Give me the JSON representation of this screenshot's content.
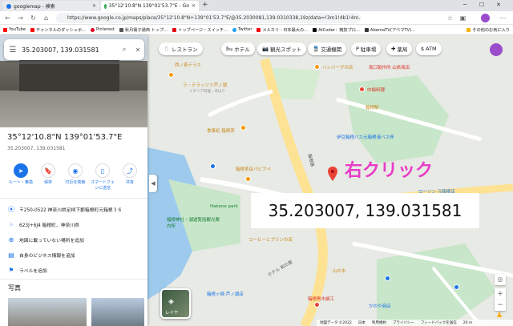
{
  "browser": {
    "tabs": [
      {
        "title": "googlemap - 検索"
      },
      {
        "title": "35°12'10.8\"N 139°01'53.7\"E - Go"
      }
    ],
    "url": "https://www.google.co.jp/maps/place/35°12'10.8\"N+139°01'53.7\"E/@35.2030081,139.0310338,19z/data=!3m1!4b1!4m...",
    "bookmarks": [
      "YouTube",
      "チャンネルのダッシュボ...",
      "Pinterest",
      "秋月電子通商 トップ...",
      "トップページ・スイッチ...",
      "Twitter",
      "メルカリ - 日本最大の...",
      "AtCoder：競技プロ...",
      "AbemaTV(アベマTV)...",
      "その他のお気に入り"
    ],
    "colors": {
      "accent": "#1a73e8",
      "annotation": "#e83cc7"
    }
  },
  "panel": {
    "search_value": "35.203007, 139.031581",
    "title": "35°12'10.8\"N 139°01'53.7\"E",
    "subtitle": "35.203007, 139.031581",
    "actions": [
      "ルート・乗換",
      "保存",
      "付近を検索",
      "スマートフォンに送信",
      "共有"
    ],
    "info": [
      {
        "icon": "pin-icon",
        "text": "〒250-0522 神奈川県足柄下郡箱根町元箱根３６"
      },
      {
        "icon": "plus-code-icon",
        "text": "623J+6J4 箱根町、神奈川県"
      },
      {
        "icon": "add-place-icon",
        "text": "地図に載っていない場所を追加"
      },
      {
        "icon": "business-icon",
        "text": "自身のビジネス情報を追加"
      },
      {
        "icon": "label-icon",
        "text": "ラベルを追加"
      }
    ],
    "photos_heading": "写真"
  },
  "map": {
    "chips": [
      {
        "icon": "restaurant-icon",
        "label": "レストラン"
      },
      {
        "icon": "hotel-icon",
        "label": "ホテル"
      },
      {
        "icon": "camera-icon",
        "label": "観光スポット"
      },
      {
        "icon": "train-icon",
        "label": "交通機関"
      },
      {
        "icon": "parking-icon",
        "label": "駐車場"
      },
      {
        "icon": "pharmacy-icon",
        "label": "薬局"
      },
      {
        "icon": "atm-icon",
        "label": "ATM"
      }
    ],
    "labels": {
      "terrace": "西ノ茶テラス",
      "bakery": "ラ・テラッツァ芦ノ湖",
      "bakery_sub": "イタリア料理・あほり",
      "hamburg": "ハンバーグの店",
      "sakaguchi": "坂口製作所 山県商店",
      "inn": "中嶋料理",
      "hakone": "箱根駅",
      "food": "食事処 箱根茶",
      "pivot": "箱根茶店バビブベ",
      "station_label": "伊豆箱根バス元箱根港バス停",
      "lawson": "ローソン 元箱根店",
      "road": "箱根路",
      "park": "Hakone park",
      "museum": "箱根神社・湖遊覧船観光案内所",
      "coffee": "コーヒーとプリンの店",
      "hotel": "ホテル 和の家",
      "yama": "山の木",
      "ashinoko": "箱根ヶ崎 芦ノ湖店",
      "kanoya": "かのや商店",
      "kamiyaku": "箱根寄木細工",
      "layer": "レイヤ"
    },
    "coordinate_callout": "35.203007, 139.031581",
    "right_click_note": "右クリック",
    "footer": [
      "地図データ ©2022",
      "日本",
      "利用規約",
      "プライバシー",
      "フィードバックを送信",
      "20 m"
    ]
  }
}
